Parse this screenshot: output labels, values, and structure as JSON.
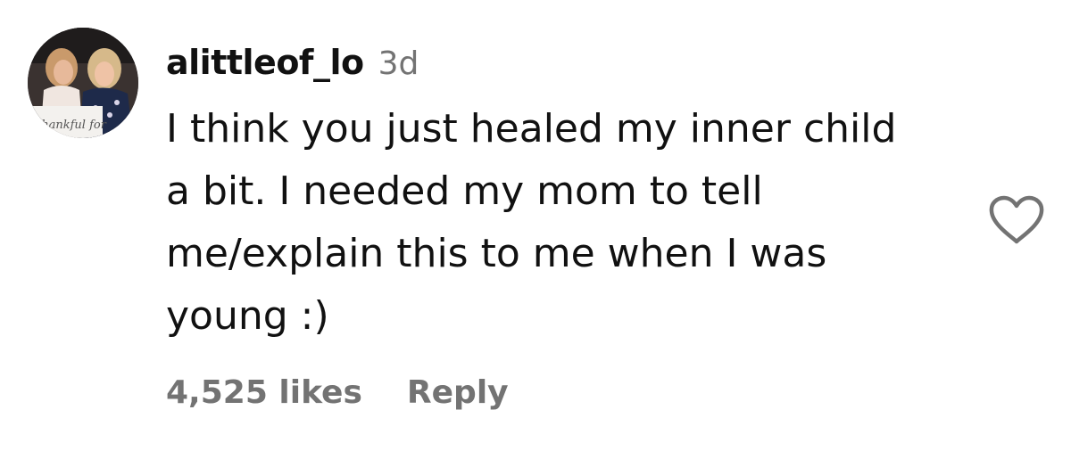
{
  "comment": {
    "username": "alittleof_lo",
    "timestamp": "3d",
    "text_lines": [
      "I think you just healed my inner child",
      "a bit. I needed my mom to tell",
      "me/explain this to me when I was",
      "young :)"
    ],
    "likes": "4,525 likes",
    "reply_label": "Reply",
    "avatar_caption": "thankful for",
    "like_icon": "heart-outline-icon"
  },
  "colors": {
    "text_primary": "#111111",
    "text_secondary": "#737373",
    "background": "#ffffff"
  }
}
